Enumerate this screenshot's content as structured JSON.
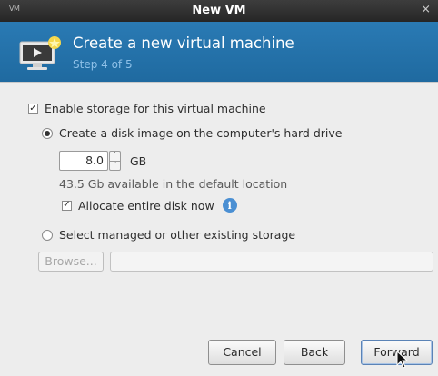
{
  "window": {
    "app_icon_text": "VM",
    "title": "New VM",
    "close_label": "×"
  },
  "header": {
    "title": "Create a new virtual machine",
    "step": "Step 4 of 5",
    "icon": "monitor-icon"
  },
  "storage": {
    "enable_label": "Enable storage for this virtual machine",
    "enable_checked": true,
    "create_disk_label": "Create a disk image on the computer's hard drive",
    "create_disk_selected": true,
    "size_value": "8.0",
    "size_unit": "GB",
    "spin_up": "˄",
    "spin_down": "˅",
    "available_text": "43.5 Gb available in the default location",
    "allocate_label": "Allocate entire disk now",
    "allocate_checked": true,
    "info_icon": "i",
    "select_managed_label": "Select managed or other existing storage",
    "select_managed_selected": false,
    "browse_label": "Browse...",
    "path_value": ""
  },
  "buttons": {
    "cancel": "Cancel",
    "back": "Back",
    "forward": "Forward"
  },
  "check_mark": "✓"
}
